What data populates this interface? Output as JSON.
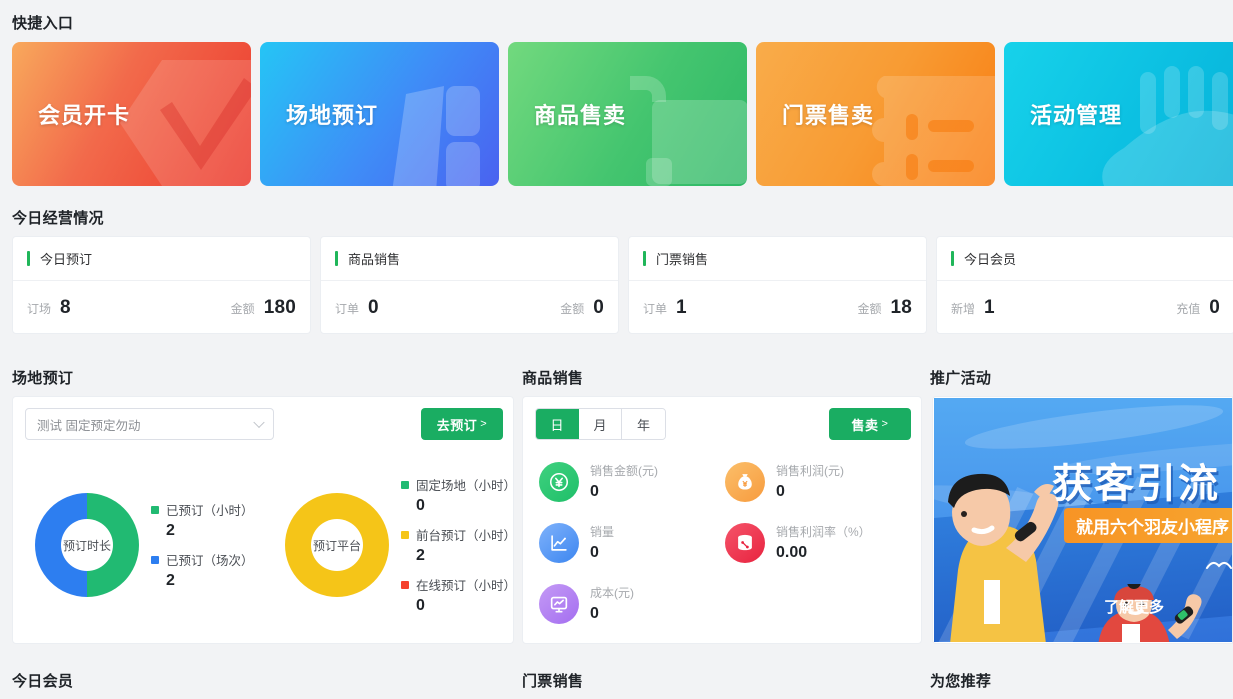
{
  "quick_entry": {
    "title": "快捷入口",
    "cards": [
      {
        "label": "会员开卡",
        "theme": "qc-red",
        "icon": "membership-card-icon",
        "color": "#ec3a2e"
      },
      {
        "label": "场地预订",
        "theme": "qc-blue",
        "icon": "venue-building-icon",
        "color": "#4a62f0"
      },
      {
        "label": "商品售卖",
        "theme": "qc-green",
        "icon": "shopping-cart-icon",
        "color": "#2eb866"
      },
      {
        "label": "门票售卖",
        "theme": "qc-orange",
        "icon": "ticket-list-icon",
        "color": "#f97d11"
      },
      {
        "label": "活动管理",
        "theme": "qc-cyan",
        "icon": "hand-wave-icon",
        "color": "#06b1d8"
      }
    ]
  },
  "today_business": {
    "title": "今日经营情况",
    "accent_color": "#20b65a",
    "cards": [
      {
        "title": "今日预订",
        "left_key": "订场",
        "left_value": "8",
        "right_key": "金额",
        "right_value": "180"
      },
      {
        "title": "商品销售",
        "left_key": "订单",
        "left_value": "0",
        "right_key": "金额",
        "right_value": "0"
      },
      {
        "title": "门票销售",
        "left_key": "订单",
        "left_value": "1",
        "right_key": "金额",
        "right_value": "18"
      },
      {
        "title": "今日会员",
        "left_key": "新增",
        "left_value": "1",
        "right_key": "充值",
        "right_value": "0"
      }
    ]
  },
  "venue": {
    "title": "场地预订",
    "select_value": "测试 固定预定勿动",
    "action_label": "去预订",
    "action_arrow": ">",
    "chart_data": [
      {
        "type": "pie",
        "title": "预订时长",
        "center_label": "预订时长",
        "categories": [
          "已预订（小时）",
          "已预订（场次）"
        ],
        "values": [
          2,
          2
        ],
        "colors": [
          "#21ba72",
          "#2d7ef0"
        ],
        "legend": "right"
      },
      {
        "type": "pie",
        "title": "预订平台",
        "center_label": "预订平台",
        "categories": [
          "固定场地（小时）",
          "前台预订（小时）",
          "在线预订（小时）"
        ],
        "values": [
          0,
          2,
          0
        ],
        "colors": [
          "#21ba72",
          "#f5c518",
          "#f5412d"
        ],
        "legend": "right"
      }
    ]
  },
  "goods": {
    "title": "商品销售",
    "tabs": [
      {
        "label": "日",
        "active": true
      },
      {
        "label": "月",
        "active": false
      },
      {
        "label": "年",
        "active": false
      }
    ],
    "action_label": "售卖",
    "action_arrow": ">",
    "metrics": [
      {
        "key": "销售金额(元)",
        "value": "0",
        "icon": "yen-coin-icon",
        "theme": "g-green"
      },
      {
        "key": "销售利润(元)",
        "value": "0",
        "icon": "money-bag-icon",
        "theme": "g-orange"
      },
      {
        "key": "销量",
        "value": "0",
        "icon": "line-chart-icon",
        "theme": "g-blue"
      },
      {
        "key": "销售利润率（%）",
        "value": "0.00",
        "icon": "database-percent-icon",
        "theme": "g-red"
      },
      {
        "key": "成本(元)",
        "value": "0",
        "icon": "presentation-icon",
        "theme": "g-purple"
      }
    ]
  },
  "promo": {
    "title": "推广活动",
    "banner": {
      "headline": "获客引流",
      "subtitle": "就用六个羽友小程序",
      "more_label": "了解更多"
    }
  },
  "bottom_sections": {
    "member": "今日会员",
    "ticket": "门票销售",
    "recommend": "为您推荐"
  }
}
